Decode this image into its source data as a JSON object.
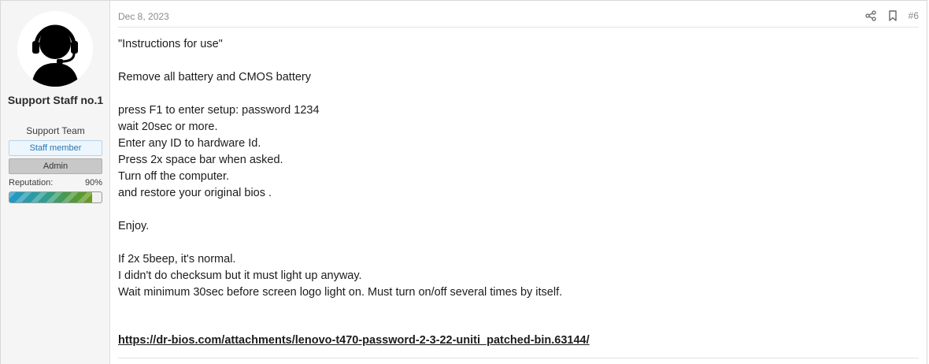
{
  "user": {
    "name": "Support Staff no.1",
    "title": "Support Team",
    "banners": [
      "Staff member",
      "Admin"
    ],
    "reputation_label": "Reputation:",
    "reputation_value": "90%",
    "reputation_fraction": 0.9
  },
  "post": {
    "date": "Dec 8, 2023",
    "number": "#6",
    "icons": [
      "share-icon",
      "bookmark-icon"
    ],
    "lines": [
      "\"Instructions for use\"",
      "",
      "Remove all battery and CMOS battery",
      "",
      "press F1 to enter setup: password 1234",
      "wait 20sec or more.",
      "Enter any ID to hardware Id.",
      "Press 2x space bar when asked.",
      "Turn off the computer.",
      "and restore your original bios .",
      "",
      "Enjoy.",
      "",
      "If 2x 5beep, it's normal.",
      "I didn't do checksum but it must light up anyway.",
      "Wait minimum 30sec before screen logo light on. Must turn on/off several times by itself."
    ],
    "link": "https://dr-bios.com/attachments/lenovo-t470-password-2-3-22-uniti_patched-bin.63144/"
  },
  "colors": {
    "staff_banner": "#2577b1",
    "link": "#1c1c1c"
  }
}
